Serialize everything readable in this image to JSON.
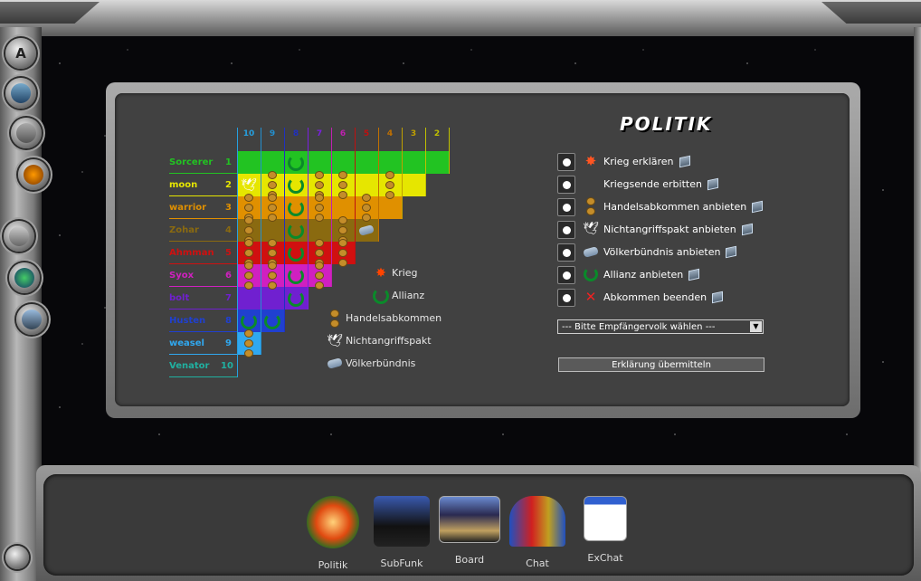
{
  "panel_title": "POLITIK",
  "column_numbers": [
    "10",
    "9",
    "8",
    "7",
    "6",
    "5",
    "4",
    "3",
    "2"
  ],
  "column_colors": [
    "#25a0e0",
    "#2390d0",
    "#2030c0",
    "#7a20e0",
    "#c020b0",
    "#c01010",
    "#c07000",
    "#c0a000",
    "#c0c000"
  ],
  "players": [
    {
      "name": "Sorcerer",
      "num": "1",
      "color": "#22c322"
    },
    {
      "name": "moon",
      "num": "2",
      "color": "#e6e600"
    },
    {
      "name": "warrior",
      "num": "3",
      "color": "#e09000"
    },
    {
      "name": "Zohar",
      "num": "4",
      "color": "#8a6a10"
    },
    {
      "name": "Ahmman",
      "num": "5",
      "color": "#d01010"
    },
    {
      "name": "Syox",
      "num": "6",
      "color": "#d020c0"
    },
    {
      "name": "bolt",
      "num": "7",
      "color": "#7020d0"
    },
    {
      "name": "Husten",
      "num": "8",
      "color": "#2040d0"
    },
    {
      "name": "weasel",
      "num": "9",
      "color": "#30a8f0"
    },
    {
      "name": "Venator",
      "num": "10",
      "color": "#20b0a0"
    }
  ],
  "legend": {
    "war": "Krieg",
    "alliance": "Allianz",
    "trade": "Handelsabkommen",
    "nonaggression": "Nichtangriffspakt",
    "union": "Völkerbündnis"
  },
  "actions": [
    {
      "label": "Krieg erklären",
      "icon": "explosion-icon"
    },
    {
      "label": "Kriegsende erbitten",
      "icon": ""
    },
    {
      "label": "Handelsabkommen anbieten",
      "icon": "trade-icon"
    },
    {
      "label": "Nichtangriffspakt anbieten",
      "icon": "dove-icon"
    },
    {
      "label": "Völkerbündnis anbieten",
      "icon": "handshake-icon"
    },
    {
      "label": "Allianz anbieten",
      "icon": "horseshoe-icon"
    },
    {
      "label": "Abkommen beenden",
      "icon": "red-x-icon"
    }
  ],
  "recipient_select": "--- Bitte Empfängervolk wählen ---",
  "submit_label": "Erklärung übermitteln",
  "dock": [
    {
      "label": "Politik"
    },
    {
      "label": "SubFunk"
    },
    {
      "label": "Board"
    },
    {
      "label": "Chat"
    },
    {
      "label": "ExChat"
    }
  ],
  "side_nav_top_label": "A"
}
